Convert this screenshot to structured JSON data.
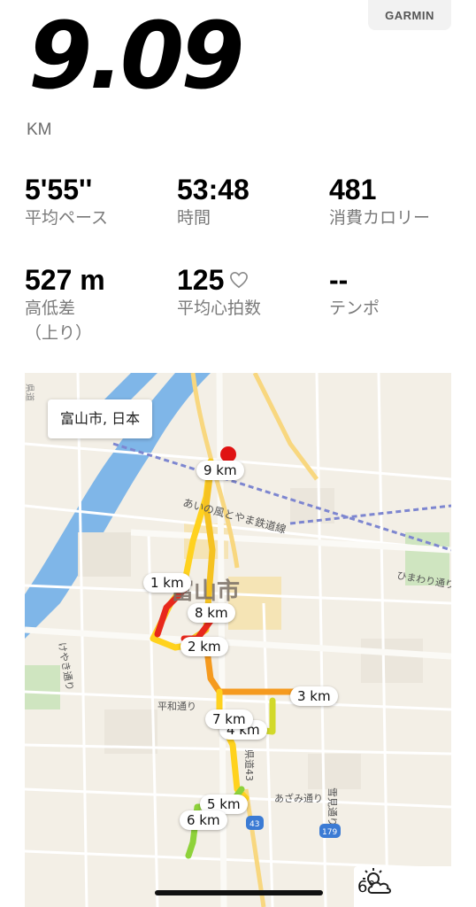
{
  "brand": "GARMIN",
  "summary": {
    "distance": "9.09",
    "unit": "KM"
  },
  "stats": [
    {
      "value": "5'55''",
      "label": "平均ペース"
    },
    {
      "value": "53:48",
      "label": "時間"
    },
    {
      "value": "481",
      "label": "消費カロリー"
    },
    {
      "value": "527 m",
      "label": "高低差\n（上り）"
    },
    {
      "value": "125",
      "label": "平均心拍数",
      "icon": "heart-outline-icon"
    },
    {
      "value": "--",
      "label": "テンポ"
    }
  ],
  "map": {
    "location": "富山市, 日本",
    "city_label": "富山市",
    "street_labels": [
      "あいの風とやま鉄道線",
      "ひまわり通り",
      "けやき通り",
      "平和通り",
      "県道43",
      "あざみ通り",
      "雪見通り",
      "県道"
    ],
    "route_shields": [
      "43",
      "179"
    ],
    "km_markers": [
      "1 km",
      "2 km",
      "3 km",
      "4 km",
      "5 km",
      "6 km",
      "7 km",
      "8 km",
      "9 km"
    ],
    "colors": {
      "route_slow": "#e8281c",
      "route_mid": "#ffd21e",
      "route_fast": "#8ed23a",
      "water": "#7fb6e8",
      "rail": "#7d86d0",
      "end_marker": "#e01212"
    }
  },
  "weather": {
    "temperature": "6°",
    "icon": "partly-cloudy-icon"
  }
}
